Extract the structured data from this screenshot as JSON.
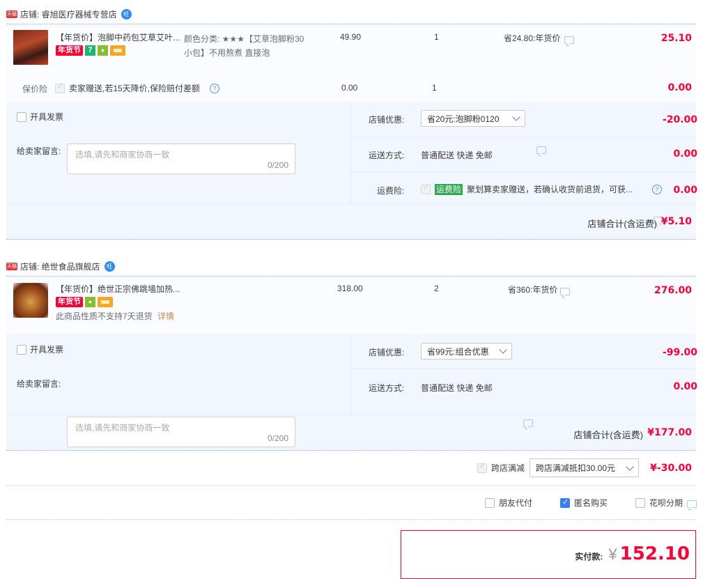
{
  "colors": {
    "accent_red": "#ff0036",
    "band_bg": "#f2f6fe",
    "tmall_red": "#e4393c",
    "blue_check": "#3a7bf6"
  },
  "shops": [
    {
      "name": "店铺: 睿旭医疗器械专营店",
      "item": {
        "title": "【年货价】泡脚中药包艾草艾叶...",
        "sku_line1": "颜色分类: ★★★【艾草泡脚粉30",
        "sku_line2": "小包】不用熬煮 直接泡",
        "price": "49.90",
        "qty": "1",
        "save": "省24.80:年货价",
        "subtotal": "25.10",
        "tag": "年货节"
      },
      "insurance": {
        "label": "保价险",
        "text": "卖家赠送,若15天降价,保险赔付差额",
        "price": "0.00",
        "qty": "1",
        "amount": "0.00"
      },
      "invoice": "开具发票",
      "message": {
        "label": "给卖家留言:",
        "placeholder": "选填,请先和商家协商一致",
        "count": "0/200"
      },
      "coupon": {
        "label": "店铺优惠:",
        "value": "省20元:泡脚粉0120",
        "amount": "-20.00"
      },
      "shipping": {
        "label": "运送方式:",
        "value": "普通配送 快递 免邮",
        "amount": "0.00"
      },
      "ship_ins": {
        "label": "运费险:",
        "badge": "运费险",
        "text": "聚划算卖家赠送，若确认收货前退货，可获...",
        "amount": "0.00"
      },
      "total": {
        "label": "店铺合计(含运费)",
        "amount": "¥5.10"
      }
    },
    {
      "name": "店铺: 绝世食品旗舰店",
      "item": {
        "title": "【年货价】绝世正宗佛跳墙加热...",
        "price": "318.00",
        "qty": "2",
        "save": "省360:年货价",
        "subtotal": "276.00",
        "tag": "年货节",
        "note": "此商品性质不支持7天退货",
        "note_link": "详情"
      },
      "invoice": "开具发票",
      "message": {
        "label": "给卖家留言:",
        "placeholder": "选填,请先和商家协商一致",
        "count": "0/200"
      },
      "coupon": {
        "label": "店铺优惠:",
        "value": "省99元:组合优惠",
        "amount": "-99.00"
      },
      "shipping": {
        "label": "运送方式:",
        "value": "普通配送 快递 免邮",
        "amount": "0.00"
      },
      "total": {
        "label": "店铺合计(含运费)",
        "amount": "¥177.00"
      }
    }
  ],
  "cross_store": {
    "label": "跨店满减",
    "value": "跨店满减抵扣30.00元",
    "amount": "¥-30.00"
  },
  "options": {
    "friend_pay": "朋友代付",
    "anonymous": "匿名购买",
    "huabei": "花呗分期"
  },
  "pay": {
    "label": "实付款:",
    "currency": "¥",
    "amount": "152.10"
  },
  "tmall_badge": "天猫",
  "wangwang": "旺"
}
